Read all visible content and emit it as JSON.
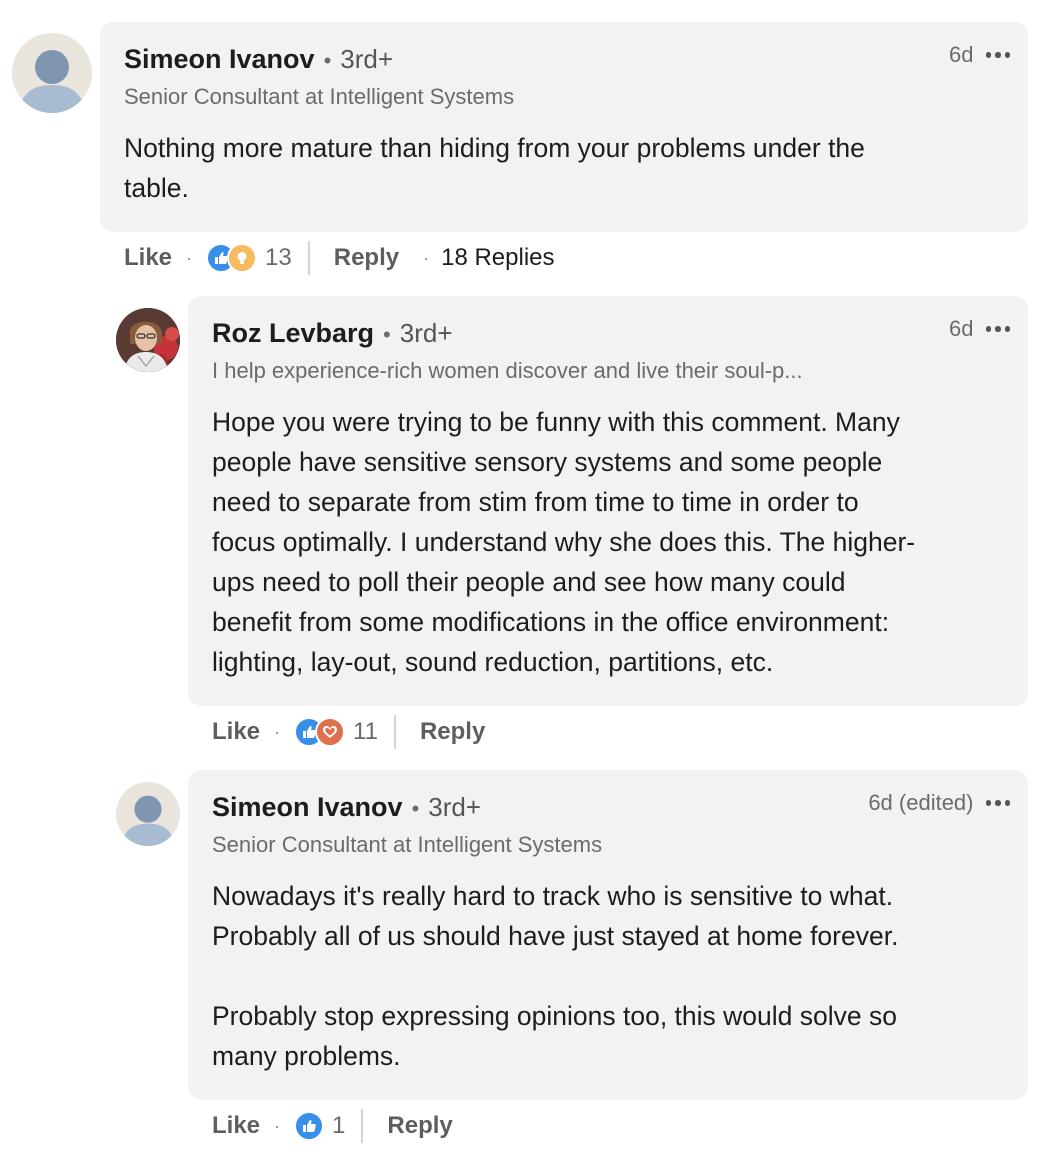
{
  "comments": [
    {
      "author": "Simeon Ivanov",
      "degree": "3rd+",
      "headline": "Senior Consultant at Intelligent Systems",
      "time": "6d",
      "text": "Nothing more mature than hiding from your problems under the\ntable.",
      "like_label": "Like",
      "reply_label": "Reply",
      "reactions": [
        "like-icon",
        "insightful-icon"
      ],
      "reaction_count": "13",
      "replies_label": "18 Replies"
    },
    {
      "author": "Roz Levbarg",
      "degree": "3rd+",
      "headline": "I help experience-rich women discover and live their soul-p...",
      "time": "6d",
      "text": "Hope you were trying to be funny with this comment. Many\npeople have sensitive sensory systems and some people\nneed to separate from stim from time to time in order to\nfocus optimally. I understand why she does this. The higher-\nups need to poll their people and see how many could\nbenefit from some modifications in the office environment:\nlighting, lay-out, sound reduction, partitions, etc.",
      "like_label": "Like",
      "reply_label": "Reply",
      "reactions": [
        "like-icon",
        "love-icon"
      ],
      "reaction_count": "11"
    },
    {
      "author": "Simeon Ivanov",
      "degree": "3rd+",
      "headline": "Senior Consultant at Intelligent Systems",
      "time": "6d (edited)",
      "text": "Nowadays it's really hard to track who is sensitive to what.\nProbably all of us should have just stayed at home forever.\n\nProbably stop expressing opinions too, this would solve so\nmany problems.",
      "like_label": "Like",
      "reply_label": "Reply",
      "reactions": [
        "like-icon"
      ],
      "reaction_count": "1"
    }
  ],
  "separator": "•",
  "action_separator": "·",
  "colors": {
    "bubble": "#f2f2f2",
    "like_reaction": "#378fe9",
    "insightful_reaction": "#f5bb5c",
    "love_reaction": "#df704d"
  }
}
